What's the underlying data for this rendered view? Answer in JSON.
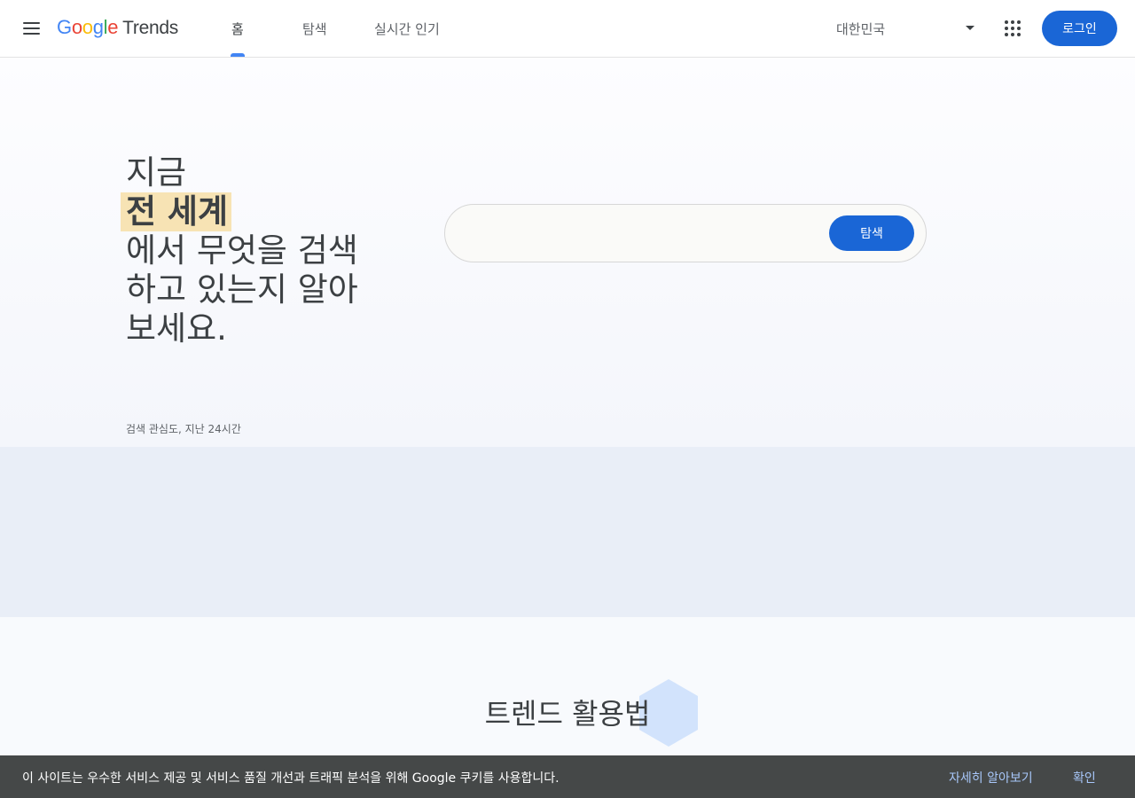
{
  "header": {
    "logo_google": [
      "G",
      "o",
      "o",
      "g",
      "l",
      "e"
    ],
    "logo_google_colors": [
      "#4285F4",
      "#EA4335",
      "#FBBC05",
      "#4285F4",
      "#34A853",
      "#EA4335"
    ],
    "logo_product": "Trends",
    "tabs": [
      {
        "label": "홈",
        "active": true
      },
      {
        "label": "탐색",
        "active": false
      },
      {
        "label": "실시간 인기",
        "active": false
      }
    ],
    "country": "대한민국",
    "login_label": "로그인",
    "accent_color": "#1A66D6"
  },
  "hero": {
    "title_line1": "지금",
    "title_highlight": "전 세계",
    "title_line3": "에서 무엇을 검색",
    "title_line4": "하고 있는지 알아",
    "title_line5": "보세요.",
    "search_value": "",
    "search_button": "탐색",
    "caption": "검색 관심도, 지난 24시간"
  },
  "section": {
    "title": "트렌드 활용법"
  },
  "cookie_bar": {
    "text": "이 사이트는 우수한 서비스 제공 및 서비스 품질 개선과 트래픽 분석을 위해 Google 쿠키를 사용합니다.",
    "learn_more": "자세히 알아보기",
    "confirm": "확인"
  }
}
